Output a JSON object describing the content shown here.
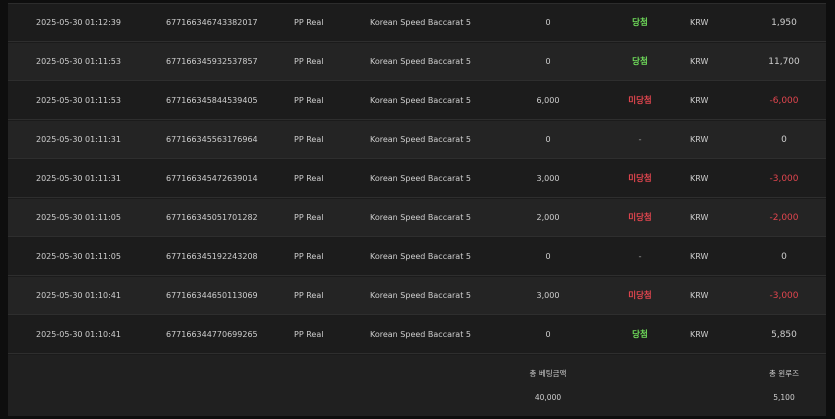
{
  "rows": [
    {
      "date": "2025-05-30 01:12:39",
      "id": "677166346743382017",
      "provider": "PP Real",
      "game": "Korean Speed Baccarat 5",
      "bet": "0",
      "result": "당첨",
      "result_type": "win",
      "currency": "KRW",
      "payout": "1,950",
      "negative": false
    },
    {
      "date": "2025-05-30 01:11:53",
      "id": "677166345932537857",
      "provider": "PP Real",
      "game": "Korean Speed Baccarat 5",
      "bet": "0",
      "result": "당첨",
      "result_type": "win",
      "currency": "KRW",
      "payout": "11,700",
      "negative": false
    },
    {
      "date": "2025-05-30 01:11:53",
      "id": "677166345844539405",
      "provider": "PP Real",
      "game": "Korean Speed Baccarat 5",
      "bet": "6,000",
      "result": "미당첨",
      "result_type": "lose",
      "currency": "KRW",
      "payout": "-6,000",
      "negative": true
    },
    {
      "date": "2025-05-30 01:11:31",
      "id": "677166345563176964",
      "provider": "PP Real",
      "game": "Korean Speed Baccarat 5",
      "bet": "0",
      "result": "-",
      "result_type": "none",
      "currency": "KRW",
      "payout": "0",
      "negative": false
    },
    {
      "date": "2025-05-30 01:11:31",
      "id": "677166345472639014",
      "provider": "PP Real",
      "game": "Korean Speed Baccarat 5",
      "bet": "3,000",
      "result": "미당첨",
      "result_type": "lose",
      "currency": "KRW",
      "payout": "-3,000",
      "negative": true
    },
    {
      "date": "2025-05-30 01:11:05",
      "id": "677166345051701282",
      "provider": "PP Real",
      "game": "Korean Speed Baccarat 5",
      "bet": "2,000",
      "result": "미당첨",
      "result_type": "lose",
      "currency": "KRW",
      "payout": "-2,000",
      "negative": true
    },
    {
      "date": "2025-05-30 01:11:05",
      "id": "677166345192243208",
      "provider": "PP Real",
      "game": "Korean Speed Baccarat 5",
      "bet": "0",
      "result": "-",
      "result_type": "none",
      "currency": "KRW",
      "payout": "0",
      "negative": false
    },
    {
      "date": "2025-05-30 01:10:41",
      "id": "677166344650113069",
      "provider": "PP Real",
      "game": "Korean Speed Baccarat 5",
      "bet": "3,000",
      "result": "미당첨",
      "result_type": "lose",
      "currency": "KRW",
      "payout": "-3,000",
      "negative": true
    },
    {
      "date": "2025-05-30 01:10:41",
      "id": "677166344770699265",
      "provider": "PP Real",
      "game": "Korean Speed Baccarat 5",
      "bet": "0",
      "result": "당첨",
      "result_type": "win",
      "currency": "KRW",
      "payout": "5,850",
      "negative": false
    }
  ],
  "totals": {
    "bet_label": "총 베팅금액",
    "bet_value": "40,000",
    "payout_label": "총 윈루즈",
    "payout_value": "5,100"
  },
  "colors": {
    "win": "#6fdc5a",
    "lose": "#e0454e",
    "background": "#0e0e0e",
    "row_odd": "#1c1c1c",
    "row_even": "#242424"
  }
}
